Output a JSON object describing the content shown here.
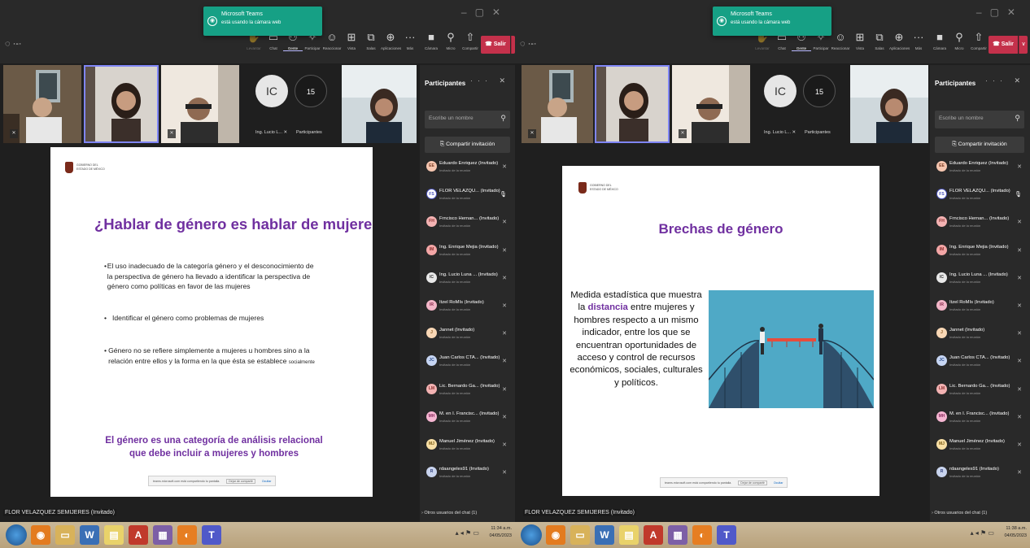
{
  "toast": {
    "title": "Microsoft Teams",
    "message": "está usando la cámara web"
  },
  "toolbar": {
    "items": [
      {
        "label": "Levantar",
        "icon": "raise-hand-icon"
      },
      {
        "label": "Chat",
        "icon": "chat-icon"
      },
      {
        "label": "Gente",
        "icon": "people-icon"
      },
      {
        "label": "Participar",
        "icon": "participate-icon"
      },
      {
        "label": "Reaccionar",
        "icon": "react-icon"
      },
      {
        "label": "Vista",
        "icon": "view-icon"
      },
      {
        "label": "Salas",
        "icon": "rooms-icon"
      },
      {
        "label": "Aplicaciones",
        "icon": "apps-icon"
      },
      {
        "label": "Más",
        "icon": "more-icon"
      }
    ],
    "call": [
      {
        "label": "Cámara",
        "icon": "camera-icon"
      },
      {
        "label": "Micro",
        "icon": "mic-icon"
      },
      {
        "label": "Compartir",
        "icon": "share-icon"
      }
    ],
    "leave_label": "Salir"
  },
  "gallery": {
    "avatar_initials": "IC",
    "avatar_caption": "Ing. Lucio L...",
    "count": "15",
    "count_caption": "Participantes"
  },
  "slides": {
    "logo_text": "GOBIERNO DEL\nESTADO DE MÉXICO",
    "left": {
      "title": "¿Hablar de género es hablar de mujeres?",
      "bullets": [
        "El uso inadecuado de la categoría género y el desconocimiento de la perspectiva de género ha llevado a identificar la perspectiva de género como políticas en favor de las mujeres",
        "Identificar el género como problemas de mujeres",
        "Género no se refiere simplemente a mujeres u hombres sino a la relación entre ellos y la forma en la que ésta se establece"
      ],
      "bullet3_tail": "socialmente",
      "footer": "El género es una categoría de análisis relacional que debe incluir a mujeres y hombres"
    },
    "right": {
      "title": "Brechas de género",
      "text_before": "Medida estadística que muestra la",
      "highlight": "distancia",
      "text_after": "entre mujeres y hombres respecto a un mismo indicador, entre los que se encuentran oportunidades de acceso y control de recursos económicos, sociales, culturales y políticos."
    }
  },
  "sharebar": {
    "message": "teams.microsoft.com está compartiendo tu pantalla.",
    "stop": "Dejar de compartir",
    "hide": "Ocultar"
  },
  "presenter": "FLOR VELAZQUEZ SEMIJERES (Invitado)",
  "panel": {
    "title": "Participantes",
    "search_placeholder": "Escribe un nombre",
    "invite": "Compartir invitación",
    "subtitle": "Invitado de la reunión",
    "others": "Otros usuarios del chat (1)",
    "participants": [
      {
        "initials": "EE",
        "name": "Eduardo Enriquez (Invitado)",
        "color": "#f6c6b0",
        "fg": "#7a3b22"
      },
      {
        "initials": "FS",
        "name": "FLOR VELAZQU...  (Invitado)",
        "color": "#ffffff",
        "fg": "#4b53bc",
        "mic_on": true
      },
      {
        "initials": "FH",
        "name": "Frncisco Hernan...  (Invitado)",
        "color": "#f4b3b3",
        "fg": "#8a2f2f"
      },
      {
        "initials": "IM",
        "name": "Ing. Enrique Mejia (Invitado)",
        "color": "#f3a6a6",
        "fg": "#8a2f2f"
      },
      {
        "initials": "IC",
        "name": "Ing. Lucio Luna ...  (Invitado)",
        "color": "#e9e9e9",
        "fg": "#333333"
      },
      {
        "initials": "IR",
        "name": "Itzel RoMIs (Invitado)",
        "color": "#f3b6c8",
        "fg": "#8a2f4f"
      },
      {
        "initials": "J",
        "name": "Jannet (Invitado)",
        "color": "#f9d7b5",
        "fg": "#8a5a22"
      },
      {
        "initials": "JC",
        "name": "Juan Carlos CTA...  (Invitado)",
        "color": "#c7d6f4",
        "fg": "#2f4f8a"
      },
      {
        "initials": "LM",
        "name": "Lic. Bernardo Ga...  (Invitado)",
        "color": "#f4b3b3",
        "fg": "#8a2f2f"
      },
      {
        "initials": "MH",
        "name": "M. en I. Francisc...  (Invitado)",
        "color": "#f6b6d2",
        "fg": "#8a2f5f"
      },
      {
        "initials": "MJ",
        "name": "Manuel Jiménez (Invitado)",
        "color": "#f9e0a6",
        "fg": "#7a5a12"
      },
      {
        "initials": "R",
        "name": "rdaangeles91 (Invitado)",
        "color": "#c9d4ee",
        "fg": "#2f3f7a"
      }
    ]
  },
  "taskbar": {
    "left": {
      "time": "11:34 a.m.",
      "date": "04/05/2023"
    },
    "right": {
      "time": "11:38 a.m.",
      "date": "04/05/2023"
    }
  },
  "colors": {
    "teams_purple": "#7f85f5",
    "leave_red": "#c4314b",
    "toast_green": "#16a085",
    "slide_title_purple": "#7030a0"
  }
}
